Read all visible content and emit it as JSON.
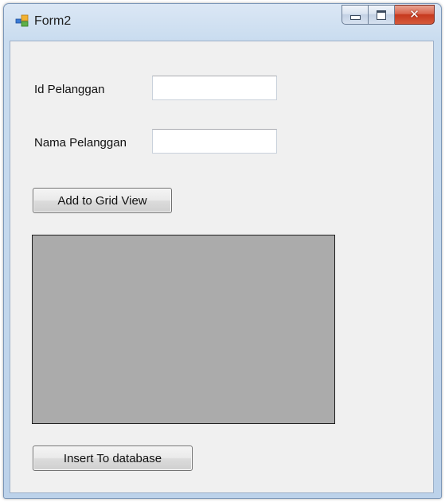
{
  "window": {
    "title": "Form2",
    "icons": {
      "app": "form-app-icon",
      "minimize": "minimize-icon",
      "maximize": "maximize-icon",
      "close": "close-icon"
    },
    "colors": {
      "frame": "#c9dcef",
      "client": "#f0f0f0",
      "close_button": "#c6391e"
    }
  },
  "form": {
    "id_label": "Id Pelanggan",
    "id_value": "",
    "name_label": "Nama Pelanggan",
    "name_value": "",
    "add_button_label": "Add to Grid View",
    "insert_button_label": "Insert To database"
  },
  "grid": {
    "background": "#ababab",
    "rows": []
  }
}
